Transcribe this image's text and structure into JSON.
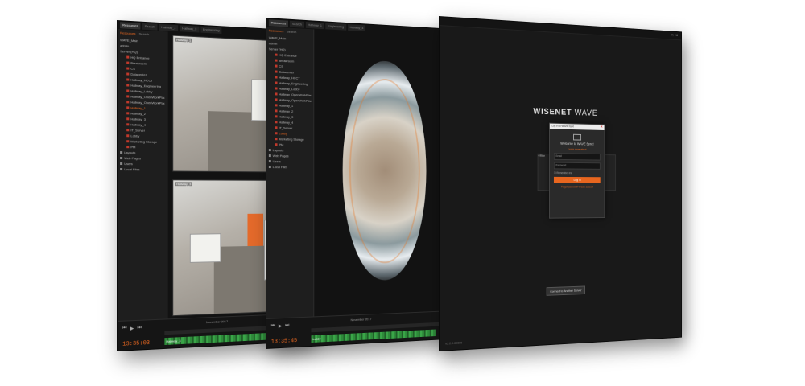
{
  "window1": {
    "tabs": [
      "Resources",
      "Search",
      "Hallway_1",
      "Hallway_3",
      "Engineering",
      "Hallway_4"
    ],
    "sidebar_tabs": [
      "Resources",
      "Search"
    ],
    "system": "WAVE_Main",
    "user": "admin",
    "server": "Server (HQ)",
    "items": [
      "HQ Entrance",
      "Breakroom",
      "CS",
      "Datacenter",
      "Hallway_HCCT",
      "Hallway_Engineering",
      "Hallway_Lobby",
      "Hallway_OpenWorkPlaceC",
      "Hallway_OpenWorkPlaceD",
      "Hallway_1",
      "Hallway_2",
      "Hallway_3",
      "Hallway_4",
      "IT_Server",
      "Lobby",
      "Marketing Storage",
      "PM"
    ],
    "selected": "Hallway_1",
    "groups": [
      "Layouts",
      "Web Pages",
      "Users",
      "Local Files"
    ],
    "cam_labels": [
      "Hallway_1",
      "Hallway_3"
    ],
    "month": "November 2017",
    "time": "13:35:03",
    "camera": "Hallway_3"
  },
  "window2": {
    "tabs": [
      "Resources",
      "Search",
      "Hallway_1",
      "Engineering",
      "Hallway_4",
      "Lobby"
    ],
    "sidebar_tabs": [
      "Resources",
      "Search"
    ],
    "system": "WAVE_Main",
    "user": "admin",
    "server": "Server (HQ)",
    "items": [
      "HQ Entrance",
      "Breakroom",
      "CS",
      "Datacenter",
      "Hallway_HCCT",
      "Hallway_Engineering",
      "Hallway_Lobby",
      "Hallway_OpenWorkPlaceC",
      "Hallway_OpenWorkPlaceD",
      "Hallway_1",
      "Hallway_2",
      "Hallway_3",
      "Hallway_4",
      "IT_Server",
      "Lobby",
      "Marketing Storage",
      "PM"
    ],
    "selected": "Lobby",
    "groups": [
      "Layouts",
      "Web Pages",
      "Users",
      "Local Files"
    ],
    "month": "November 2017",
    "time": "13:35:45",
    "camera": "Lobby"
  },
  "window3": {
    "logo_bold": "WISENET",
    "logo_light": "WAVE",
    "dialog_title": "Log in to WAVE Sync",
    "welcome": "Welcome to WAVE Sync!",
    "sub_link": "Learn more about",
    "field1": "Email",
    "field2": "Password",
    "remember": "Remember me",
    "login": "Log In",
    "links": "Forgot password?   Create account",
    "card_left": "Offline",
    "card_right": "",
    "connect": "Connect to Another Server",
    "version": "v3.2.0.00000"
  }
}
